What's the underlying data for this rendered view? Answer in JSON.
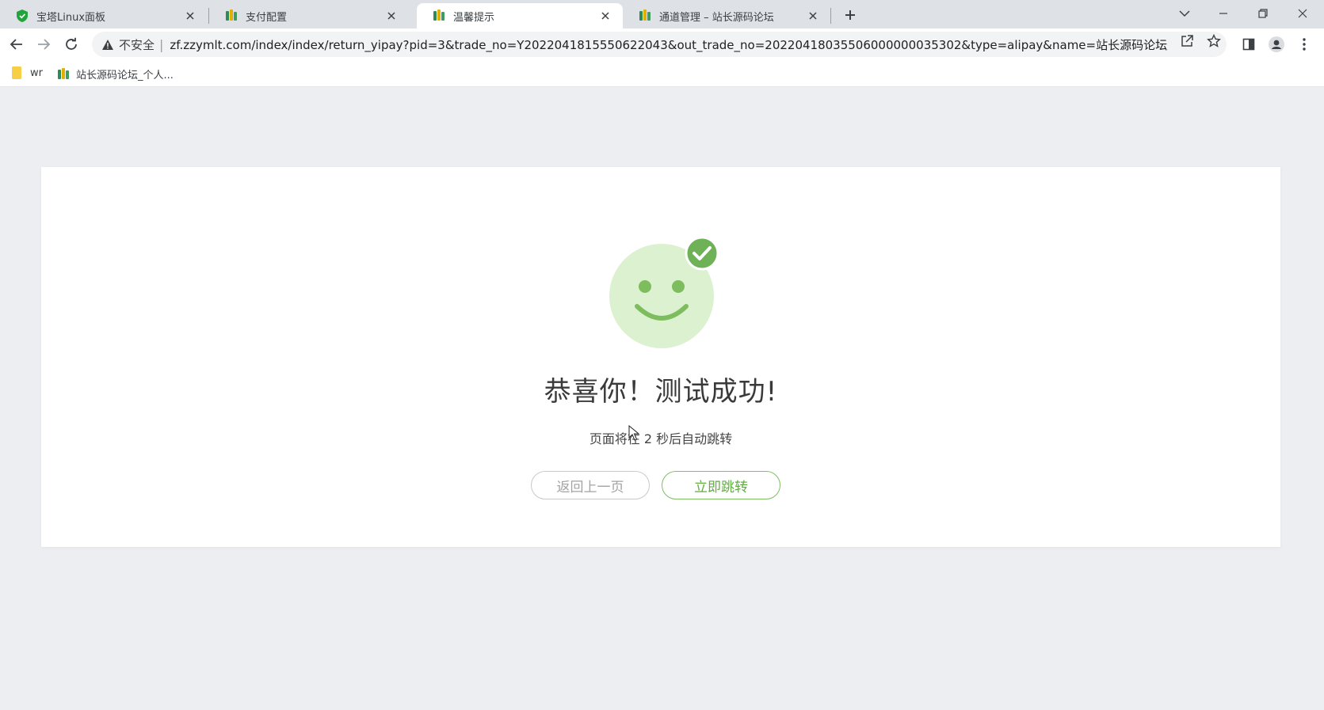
{
  "tabs": [
    {
      "title": "宝塔Linux面板",
      "icon": "shield-icon",
      "active": false
    },
    {
      "title": "支付配置",
      "icon": "forum-logo-icon",
      "active": false
    },
    {
      "title": "温馨提示",
      "icon": "forum-logo-icon",
      "active": true
    },
    {
      "title": "通道管理 – 站长源码论坛",
      "icon": "forum-logo-icon",
      "active": false
    }
  ],
  "address_bar": {
    "security_label": "不安全",
    "url": "zf.zzymlt.com/index/index/return_yipay?pid=3&trade_no=Y2022041815550622043&out_trade_no=20220418035506000000035302&type=alipay&name=站长源码论坛用户..."
  },
  "bookmarks": [
    {
      "label": "wr",
      "icon": "folder-icon"
    },
    {
      "label": "站长源码论坛_个人...",
      "icon": "forum-logo-icon"
    }
  ],
  "page": {
    "headline": "恭喜你！测试成功!",
    "countdown": "页面将在 2 秒后自动跳转",
    "back_button": "返回上一页",
    "go_button": "立即跳转"
  },
  "colors": {
    "accent_green": "#5fae3f",
    "smiley_fill": "#dbf1d0",
    "check_badge": "#6fb156"
  }
}
